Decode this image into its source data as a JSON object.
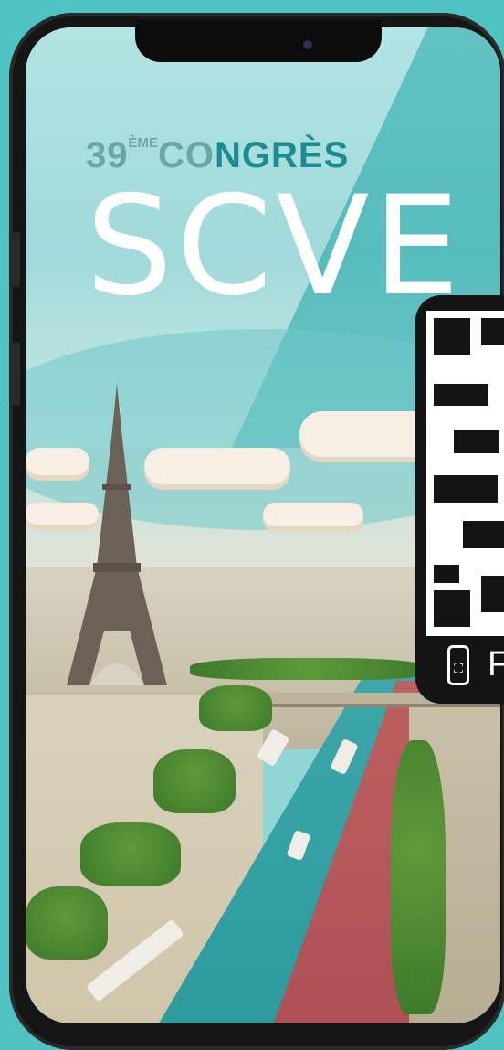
{
  "poster": {
    "edition": "39",
    "edition_sup": "ÈME",
    "congres_light": "CO",
    "congres_dark": "NGRÈS",
    "logo": "SCVE"
  },
  "qr_panel": {
    "caption": "F",
    "scan_icon": "scan-icon"
  },
  "colors": {
    "background": "#4ec3c2",
    "accent_teal": "#1b8c8f",
    "river_red": "#c85a5a"
  }
}
